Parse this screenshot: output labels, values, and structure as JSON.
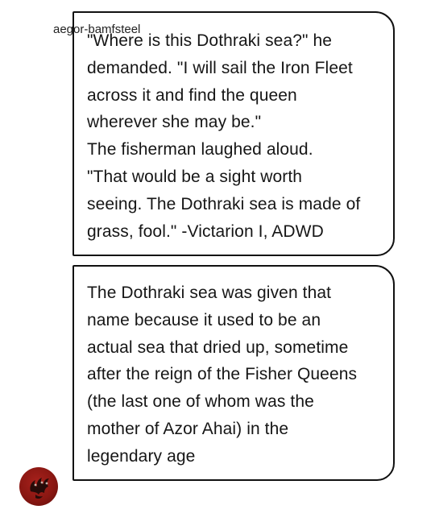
{
  "posts": [
    {
      "text": "\"Where is this Dothraki sea?\" he\ndemanded. \"I will sail the Iron Fleet\nacross it and find the queen\nwherever she may be.\"\nThe fisherman laughed aloud.\n\"That would be a sight worth\nseeing. The Dothraki sea is made of\ngrass, fool.\" -Victarion I, ADWD"
    },
    {
      "text": "The Dothraki sea was given that\nname because it used to be an\nactual sea that dried up, sometime\nafter the reign of the Fisher Queens\n(the last one of whom was the\nmother of Azor Ahai) in the\nlegendary age"
    }
  ],
  "author": {
    "username": "aegor-bamfsteel",
    "avatar_icon": "targaryen-dragon-sigil-icon",
    "avatar_color": "#8a1712"
  }
}
